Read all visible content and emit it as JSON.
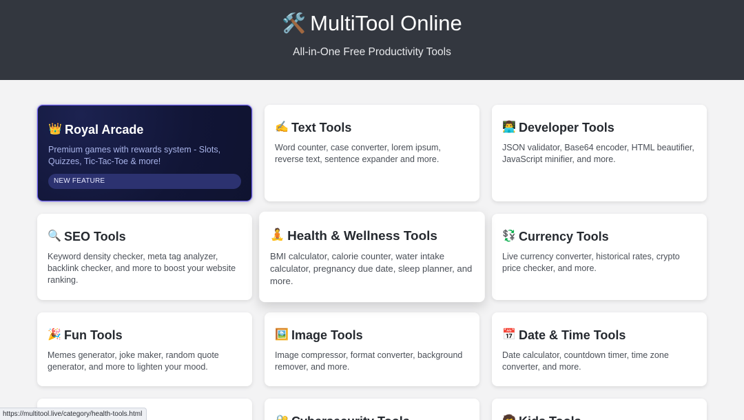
{
  "header": {
    "icon": "🛠️",
    "title": "MultiTool Online",
    "tagline": "All-in-One Free Productivity Tools"
  },
  "cards": [
    {
      "icon": "👑",
      "title": "Royal Arcade",
      "description": "Premium games with rewards system - Slots, Quizzes, Tic-Tac-Toe & more!",
      "badge": "NEW FEATURE"
    },
    {
      "icon": "✍️",
      "title": "Text Tools",
      "description": "Word counter, case converter, lorem ipsum, reverse text, sentence expander and more."
    },
    {
      "icon": "👨‍💻",
      "title": "Developer Tools",
      "description": "JSON validator, Base64 encoder, HTML beautifier, JavaScript minifier, and more."
    },
    {
      "icon": "🔍",
      "title": "SEO Tools",
      "description": "Keyword density checker, meta tag analyzer, backlink checker, and more to boost your website ranking."
    },
    {
      "icon": "🧘",
      "title": "Health & Wellness Tools",
      "description": "BMI calculator, calorie counter, water intake calculator, pregnancy due date, sleep planner, and more."
    },
    {
      "icon": "💱",
      "title": "Currency Tools",
      "description": "Live currency converter, historical rates, crypto price checker, and more."
    },
    {
      "icon": "🎉",
      "title": "Fun Tools",
      "description": "Memes generator, joke maker, random quote generator, and more to lighten your mood."
    },
    {
      "icon": "🖼️",
      "title": "Image Tools",
      "description": "Image compressor, format converter, background remover, and more."
    },
    {
      "icon": "📅",
      "title": "Date & Time Tools",
      "description": "Date calculator, countdown timer, time zone converter, and more."
    },
    {
      "icon": "",
      "title": "",
      "description": ""
    },
    {
      "icon": "🔐",
      "title": "Cybersecurity Tools",
      "description": ""
    },
    {
      "icon": "🧒",
      "title": "Kids Tools",
      "description": ""
    }
  ],
  "status_bar": {
    "url": "https://multitool.live/category/health-tools.html"
  }
}
